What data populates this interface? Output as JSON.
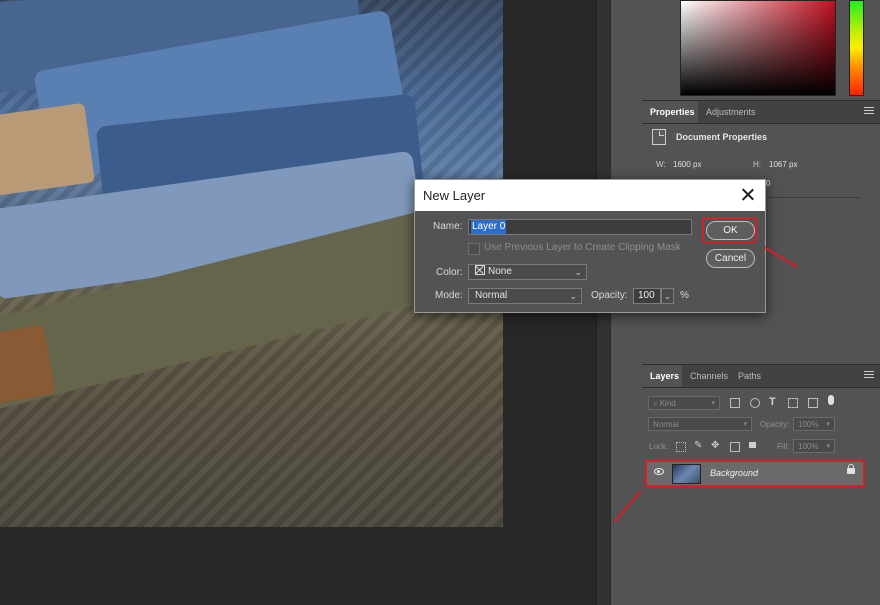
{
  "canvas": {
    "image_description_icon": "denim-photo"
  },
  "color_panel": {
    "field_color": "#c01020"
  },
  "properties": {
    "tabs": [
      {
        "label": "Properties"
      },
      {
        "label": "Adjustments"
      }
    ],
    "section_title": "Document Properties",
    "width_label": "W:",
    "width_value": "1600 px",
    "height_label": "H:",
    "height_value": "1067 px",
    "extra_value": "0"
  },
  "dialog": {
    "title": "New Layer",
    "name_label": "Name:",
    "name_value": "Layer 0",
    "clip_label": "Use Previous Layer to Create Clipping Mask",
    "color_label": "Color:",
    "color_value": "None",
    "mode_label": "Mode:",
    "mode_value": "Normal",
    "opacity_label": "Opacity:",
    "opacity_value": "100",
    "opacity_unit": "%",
    "ok_label": "OK",
    "cancel_label": "Cancel"
  },
  "layers": {
    "tabs": [
      {
        "label": "Layers"
      },
      {
        "label": "Channels"
      },
      {
        "label": "Paths"
      }
    ],
    "filter_kind": "Kind",
    "blend_mode": "Normal",
    "opacity_label": "Opacity:",
    "opacity_value": "100%",
    "lock_label": "Lock:",
    "fill_label": "Fill:",
    "fill_value": "100%",
    "layer_items": [
      {
        "name": "Background",
        "visible": true,
        "locked": true
      }
    ]
  },
  "annotation": {
    "highlight_color": "#d91f26"
  }
}
